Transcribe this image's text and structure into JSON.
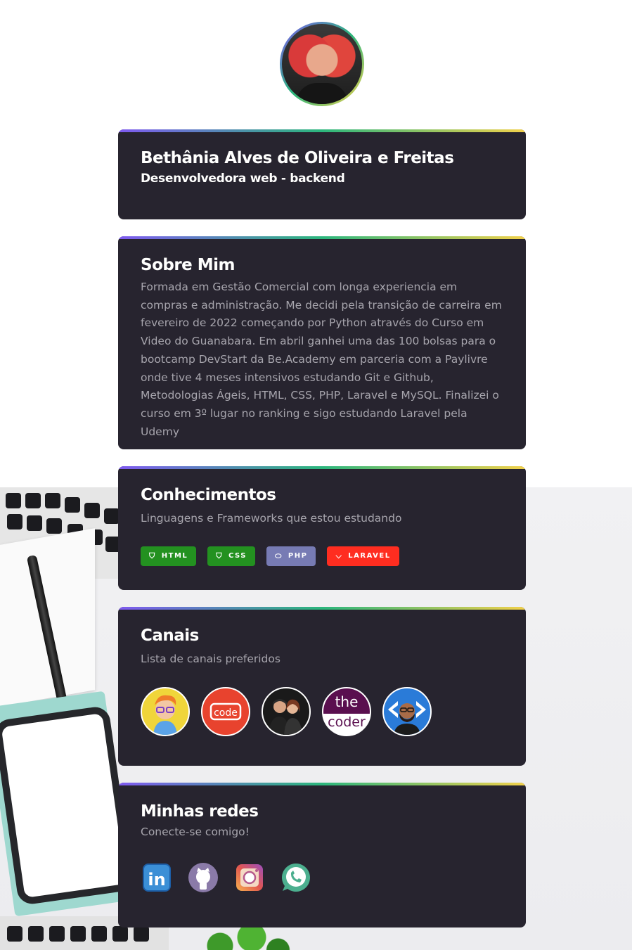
{
  "profile": {
    "name": "Bethânia Alves de Oliveira e Freitas",
    "role": "Desenvolvedora web - backend"
  },
  "about": {
    "title": "Sobre Mim",
    "text": "Formada em Gestão Comercial com longa experiencia em compras e administração. Me decidi pela transição de carreira em fevereiro de 2022 começando por Python através do Curso em Video do Guanabara. Em abril ganhei uma das 100 bolsas para o bootcamp DevStart da Be.Academy em parceria com a Paylivre onde tive 4 meses intensivos estudando Git e Github, Metodologias Ágeis, HTML, CSS, PHP, Laravel e MySQL. Finalizei o curso em 3º lugar no ranking e sigo estudando Laravel pela Udemy"
  },
  "skills": {
    "title": "Conhecimentos",
    "subtitle": "Linguagens e Frameworks que estou estudando",
    "badges": [
      {
        "label": "HTML",
        "color": "#239120",
        "icon": "html5-icon"
      },
      {
        "label": "CSS",
        "color": "#239120",
        "icon": "css3-icon"
      },
      {
        "label": "PHP",
        "color": "#777bb4",
        "icon": "php-icon"
      },
      {
        "label": "LARAVEL",
        "color": "#ff2d20",
        "icon": "laravel-icon"
      }
    ]
  },
  "channels": {
    "title": "Canais",
    "subtitle": "Lista de canais preferidos",
    "items": [
      {
        "name": "channel-avatar-1",
        "icon": "cartoon-avatar-icon"
      },
      {
        "name": "channel-code",
        "label": "code",
        "icon": "code-logo-icon"
      },
      {
        "name": "channel-couple",
        "icon": "people-avatar-icon"
      },
      {
        "name": "channel-the-coder",
        "label_top": "the",
        "label_bottom": "coder",
        "icon": "the-coder-logo-icon"
      },
      {
        "name": "channel-dev",
        "icon": "dev-avatar-icon"
      }
    ]
  },
  "socials": {
    "title": "Minhas redes",
    "subtitle": "Conecte-se comigo!",
    "items": [
      {
        "name": "linkedin",
        "label": "in",
        "icon": "linkedin-icon",
        "color": "#3b8fd6"
      },
      {
        "name": "github",
        "icon": "github-icon",
        "color": "#8a7aa8"
      },
      {
        "name": "instagram",
        "icon": "instagram-icon",
        "color": "#e27a4f"
      },
      {
        "name": "whatsapp",
        "icon": "whatsapp-icon",
        "color": "#4caf8f"
      }
    ]
  },
  "colors": {
    "card_bg": "#27242f",
    "accent_gradient": [
      "#7f5af0",
      "#2cb67d",
      "#f2d14b"
    ],
    "muted_text": "#a7a5ad"
  }
}
